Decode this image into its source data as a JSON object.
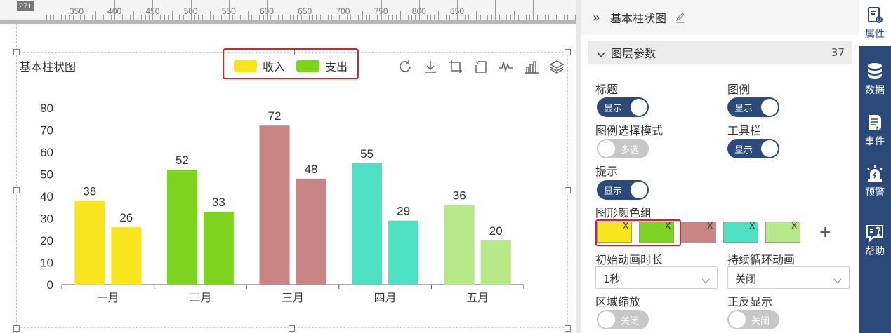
{
  "canvas": {
    "ruler_position": "271",
    "ruler_labels": [
      "350",
      "400",
      "450",
      "500",
      "550",
      "600",
      "650",
      "700",
      "750",
      "800",
      "850"
    ],
    "chart": {
      "title": "基本柱状图",
      "legend": [
        {
          "name": "收入",
          "color": "#f9e51d"
        },
        {
          "name": "支出",
          "color": "#7ed321"
        }
      ],
      "toolbar_icons": [
        "refresh-icon",
        "download-icon",
        "crop-icon",
        "crop-reset-icon",
        "line-chart-icon",
        "bar-chart-icon",
        "stack-icon"
      ]
    }
  },
  "chart_data": {
    "type": "bar",
    "title": "基本柱状图",
    "categories": [
      "一月",
      "二月",
      "三月",
      "四月",
      "五月"
    ],
    "series": [
      {
        "name": "收入",
        "values": [
          38,
          52,
          72,
          55,
          36
        ]
      },
      {
        "name": "支出",
        "values": [
          26,
          33,
          48,
          29,
          20
        ]
      }
    ],
    "category_colors": [
      "#f9e51d",
      "#7ed321",
      "#c98585",
      "#4ee0c2",
      "#b7e887"
    ],
    "ylim": [
      0,
      80
    ],
    "yticks": [
      0,
      10,
      20,
      30,
      40,
      50,
      60,
      70,
      80
    ],
    "grid": false,
    "legend_position": "top-center"
  },
  "panel": {
    "header_title": "基本柱状图",
    "group_title": "图层参数",
    "group_count": "37",
    "fields": {
      "title_label": "标题",
      "title_toggle": "显示",
      "legend_label": "图例",
      "legend_toggle": "显示",
      "legend_mode_label": "图例选择模式",
      "legend_mode_toggle": "多选",
      "toolbar_label": "工具栏",
      "toolbar_toggle": "显示",
      "tooltip_label": "提示",
      "tooltip_toggle": "显示",
      "colors_label": "图形颜色组",
      "anim_label": "初始动画时长",
      "anim_value": "1秒",
      "loop_label": "持续循环动画",
      "loop_value": "关闭",
      "zoom_label": "区域缩放",
      "zoom_toggle": "关闭",
      "reverse_label": "正反显示",
      "reverse_toggle": "关闭"
    },
    "colors": [
      "#f9e51d",
      "#7ed321",
      "#c98585",
      "#4ee0c2",
      "#b7e887"
    ],
    "add_color": "+",
    "remove_mark": "X"
  },
  "sidebar": {
    "items": [
      {
        "label": "属性",
        "icon": "properties-icon",
        "active": true
      },
      {
        "label": "数据",
        "icon": "database-icon",
        "active": false
      },
      {
        "label": "事件",
        "icon": "event-icon",
        "active": false
      },
      {
        "label": "预警",
        "icon": "alarm-icon",
        "active": false
      },
      {
        "label": "帮助",
        "icon": "help-icon",
        "active": false
      }
    ]
  }
}
